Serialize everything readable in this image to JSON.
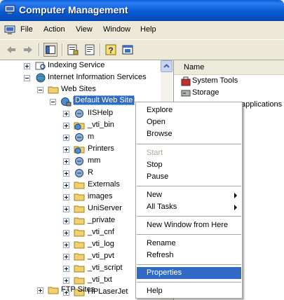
{
  "window": {
    "title": "Computer Management"
  },
  "menu": [
    "File",
    "Action",
    "View",
    "Window",
    "Help"
  ],
  "tree": {
    "indexing": "Indexing Service",
    "iis": "Internet Information Services",
    "websites": "Web Sites",
    "default_site": "Default Web Site",
    "children": [
      "IISHelp",
      "_vti_bin",
      "m",
      "Printers",
      "mm",
      "R",
      "Externals",
      "images",
      "UniServer",
      "_private",
      "_vti_cnf",
      "_vti_log",
      "_vti_pvt",
      "_vti_script",
      "_vti_txt",
      "HPLaserJet"
    ],
    "ftp": "FTP Sites"
  },
  "list": {
    "header": "Name",
    "rows": [
      "System Tools",
      "Storage",
      "applications"
    ]
  },
  "context_menu": {
    "explore": "Explore",
    "open": "Open",
    "browse": "Browse",
    "start": "Start",
    "stop": "Stop",
    "pause": "Pause",
    "new": "New",
    "all_tasks": "All Tasks",
    "new_window": "New Window from Here",
    "rename": "Rename",
    "refresh": "Refresh",
    "properties": "Properties",
    "help": "Help"
  }
}
